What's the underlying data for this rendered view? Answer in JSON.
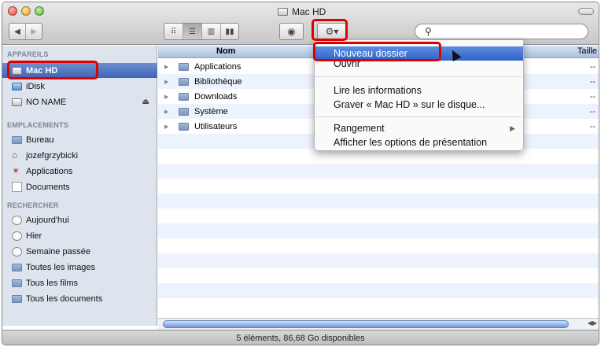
{
  "window": {
    "title": "Mac HD"
  },
  "toolbar": {
    "nav": {
      "back_icon": "back-arrow-icon",
      "forward_icon": "forward-arrow-icon"
    },
    "view_modes": [
      "icon-view-icon",
      "list-view-icon",
      "column-view-icon",
      "coverflow-view-icon"
    ],
    "quicklook_icon": "eye-icon",
    "action_icon": "gear-icon",
    "search": {
      "placeholder": "",
      "icon": "magnifier-icon"
    }
  },
  "sidebar": {
    "sections": [
      {
        "title": "APPAREILS",
        "items": [
          {
            "label": "Mac HD",
            "icon": "hard-disk-icon",
            "selected": true
          },
          {
            "label": "iDisk",
            "icon": "idisk-icon"
          },
          {
            "label": "NO NAME",
            "icon": "disk-icon",
            "eject": "eject-icon"
          }
        ]
      },
      {
        "title": "EMPLACEMENTS",
        "items": [
          {
            "label": "Bureau",
            "icon": "desktop-icon"
          },
          {
            "label": "jozefgrzybicki",
            "icon": "home-icon"
          },
          {
            "label": "Applications",
            "icon": "applications-icon"
          },
          {
            "label": "Documents",
            "icon": "documents-icon"
          }
        ]
      },
      {
        "title": "RECHERCHER",
        "items": [
          {
            "label": "Aujourd'hui",
            "icon": "clock-icon"
          },
          {
            "label": "Hier",
            "icon": "clock-icon"
          },
          {
            "label": "Semaine passée",
            "icon": "clock-icon"
          },
          {
            "label": "Toutes les images",
            "icon": "smart-folder-icon"
          },
          {
            "label": "Tous les films",
            "icon": "smart-folder-icon"
          },
          {
            "label": "Tous les documents",
            "icon": "smart-folder-icon"
          }
        ]
      }
    ]
  },
  "list": {
    "columns": {
      "name": "Nom",
      "size": "Taille"
    },
    "rows": [
      {
        "name": "Applications",
        "size": "--"
      },
      {
        "name": "Bibliothèque",
        "size": "--"
      },
      {
        "name": "Downloads",
        "size": "--"
      },
      {
        "name": "Système",
        "size": "--"
      },
      {
        "name": "Utilisateurs",
        "size": "--"
      }
    ]
  },
  "context_menu": {
    "items": [
      "Nouveau dossier",
      "Ouvrir",
      "Lire les informations",
      "Graver « Mac HD » sur le disque...",
      "Rangement",
      "Afficher les options de présentation"
    ],
    "active": "Nouveau dossier"
  },
  "status": {
    "text": "5 éléments, 86,68 Go disponibles"
  },
  "colors": {
    "highlight_border": "#e00000",
    "selection_blue": "#3e64b6",
    "menu_active": "#2f62c9"
  }
}
